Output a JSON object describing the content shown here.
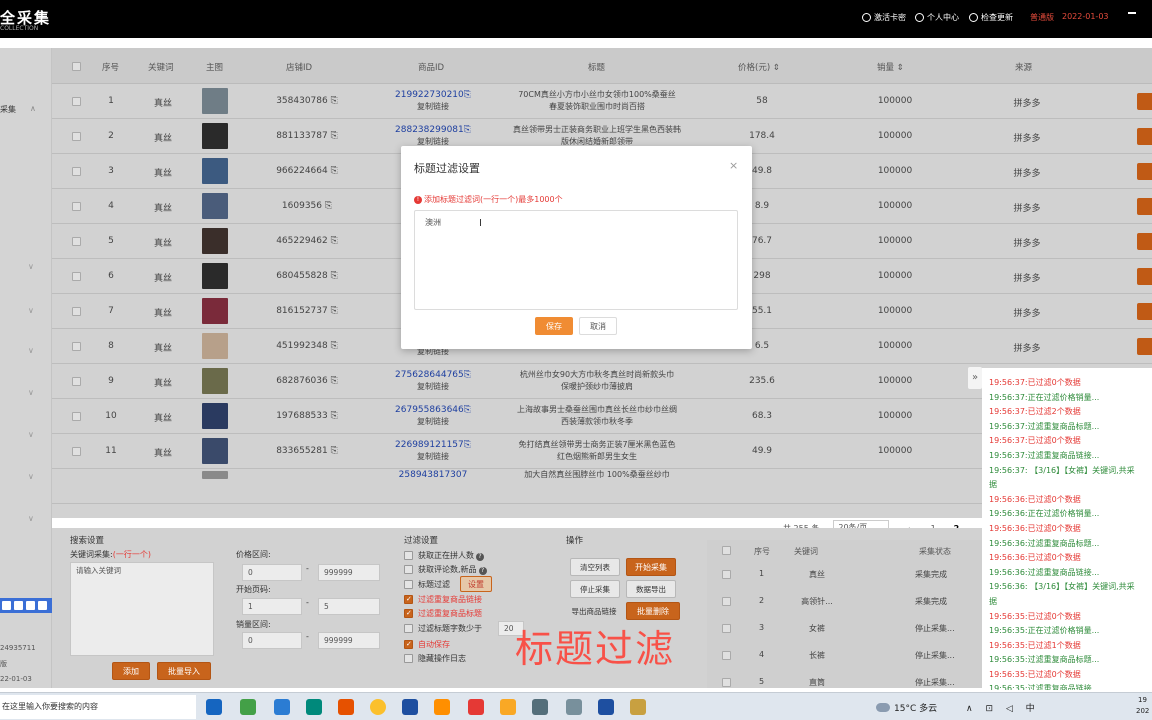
{
  "topbar": {
    "logo": "全采集",
    "logo_sub": "COLLECTION",
    "items": [
      "激活卡密",
      "个人中心",
      "检查更新"
    ],
    "version": "普通版",
    "date": "2022-01-03"
  },
  "sidebar": {
    "label": "采集",
    "account_id": "24935711",
    "version": "版",
    "date": "22-01-03"
  },
  "table": {
    "headers": [
      "序号",
      "关键词",
      "主图",
      "店铺ID",
      "商品ID",
      "标题",
      "价格(元)",
      "销量",
      "来源"
    ],
    "copy_link": "复制链接",
    "rows": [
      {
        "no": "1",
        "kw": "真丝",
        "shop": "358430786",
        "pid": "219922730210",
        "t1": "70CM真丝小方巾小丝巾女领巾100%桑蚕丝",
        "t2": "春夏装饰职业围巾时尚百搭",
        "price": "58",
        "sales": "100000",
        "src": "拼多多"
      },
      {
        "no": "2",
        "kw": "真丝",
        "shop": "881133787",
        "pid": "288238299081",
        "t1": "真丝领带男士正装商务职业上班学生黑色西装韩",
        "t2": "版休闲结婚新郎领带",
        "price": "178.4",
        "sales": "100000",
        "src": "拼多多"
      },
      {
        "no": "3",
        "kw": "真丝",
        "shop": "966224664",
        "pid": "2",
        "t1": "",
        "t2": "",
        "price": "49.8",
        "sales": "100000",
        "src": "拼多多"
      },
      {
        "no": "4",
        "kw": "真丝",
        "shop": "1609356",
        "pid": "2",
        "t1": "",
        "t2": "",
        "price": "8.9",
        "sales": "100000",
        "src": "拼多多"
      },
      {
        "no": "5",
        "kw": "真丝",
        "shop": "465229462",
        "pid": "2",
        "t1": "",
        "t2": "",
        "price": "76.7",
        "sales": "100000",
        "src": "拼多多"
      },
      {
        "no": "6",
        "kw": "真丝",
        "shop": "680455828",
        "pid": "2",
        "t1": "",
        "t2": "",
        "price": "298",
        "sales": "100000",
        "src": "拼多多"
      },
      {
        "no": "7",
        "kw": "真丝",
        "shop": "816152737",
        "pid": "2",
        "t1": "",
        "t2": "",
        "price": "55.1",
        "sales": "100000",
        "src": "拼多多"
      },
      {
        "no": "8",
        "kw": "真丝",
        "shop": "451992348",
        "pid": "",
        "t1": "",
        "t2": "女防晒纱巾披肩百搭丝巾",
        "price": "6.5",
        "sales": "100000",
        "src": "拼多多"
      },
      {
        "no": "9",
        "kw": "真丝",
        "shop": "682876036",
        "pid": "275628644765",
        "t1": "杭州丝巾女90大方巾秋冬真丝时尚新款头巾",
        "t2": "保暖护颈纱巾薄披肩",
        "price": "235.6",
        "sales": "100000",
        "src": "拼多多"
      },
      {
        "no": "10",
        "kw": "真丝",
        "shop": "197688533",
        "pid": "267955863646",
        "t1": "上海故事男士桑蚕丝围巾真丝长丝巾纱巾丝绸",
        "t2": "西装薄款领巾秋冬季",
        "price": "68.3",
        "sales": "100000",
        "src": "拼多多"
      },
      {
        "no": "11",
        "kw": "真丝",
        "shop": "833655281",
        "pid": "226989121157",
        "t1": "免打结真丝领带男士商务正装7厘米黑色蓝色",
        "t2": "红色烟熊新郎男生女生",
        "price": "49.9",
        "sales": "100000",
        "src": "拼多多"
      }
    ],
    "partial_row_pid": "258943817307",
    "partial_row_title": "加大自然真丝围脖丝巾 100%桑蚕丝纱巾"
  },
  "modal": {
    "title": "标题过滤设置",
    "close": "×",
    "hint": "添加标题过滤词(一行一个)最多1000个",
    "value": "澳洲",
    "save": "保存",
    "cancel": "取消"
  },
  "pagination": {
    "total": "共 255 条",
    "size": "20条/页",
    "prev": "‹",
    "p1": "1",
    "p2": "2"
  },
  "search_settings": {
    "title": "搜索设置",
    "kw_label": "关键词采集:",
    "kw_hint": "(一行一个)",
    "kw_placeholder": "请输入关键词",
    "price_label": "价格区间:",
    "price_min": "0",
    "price_max": "999999",
    "page_label": "开始页码:",
    "page_min": "1",
    "page_max": "5",
    "sales_label": "销量区间:",
    "sales_min": "0",
    "sales_max": "999999",
    "add": "添加",
    "batch_import": "批量导入"
  },
  "filter_settings": {
    "title": "过滤设置",
    "items": [
      "获取正在拼人数",
      "获取评论数,新品",
      "标题过滤",
      "过滤重复商品链接",
      "过滤重复商品标题",
      "过滤标题字数少于",
      "自动保存",
      "隐藏操作日志"
    ],
    "set_btn": "设置",
    "min_chars": "20"
  },
  "operations": {
    "title": "操作",
    "buttons": [
      "清空列表",
      "开始采集",
      "停止采集",
      "数据导出",
      "导出商品链接",
      "批量删除"
    ]
  },
  "task_table": {
    "headers": [
      "序号",
      "关键词",
      "采集状态"
    ],
    "rows": [
      {
        "no": "1",
        "kw": "真丝",
        "status": "采集完成"
      },
      {
        "no": "2",
        "kw": "高领针...",
        "status": "采集完成"
      },
      {
        "no": "3",
        "kw": "女裤",
        "status": "停止采集..."
      },
      {
        "no": "4",
        "kw": "长裤",
        "status": "停止采集..."
      },
      {
        "no": "5",
        "kw": "直筒",
        "status": "停止采集..."
      }
    ]
  },
  "overlay_text": "标题过滤",
  "log": {
    "collapse": "»",
    "lines": [
      {
        "t": "19:56:37:已过滤0个数据",
        "c": "red"
      },
      {
        "t": "19:56:37:正在过滤价格销量...",
        "c": "green"
      },
      {
        "t": "19:56:37:已过滤2个数据",
        "c": "red"
      },
      {
        "t": "19:56:37:过滤重复商品标题...",
        "c": "green"
      },
      {
        "t": "19:56:37:已过滤0个数据",
        "c": "red"
      },
      {
        "t": "19:56:37:过滤重复商品链接...",
        "c": "green"
      },
      {
        "t": "19:56:37: 【3/16】【女裤】关键词,共采",
        "c": "green"
      },
      {
        "t": "据",
        "c": "green"
      },
      {
        "t": "19:56:36:已过滤0个数据",
        "c": "red"
      },
      {
        "t": "19:56:36:正在过滤价格销量...",
        "c": "green"
      },
      {
        "t": "19:56:36:已过滤0个数据",
        "c": "red"
      },
      {
        "t": "19:56:36:过滤重复商品标题...",
        "c": "green"
      },
      {
        "t": "19:56:36:已过滤0个数据",
        "c": "red"
      },
      {
        "t": "19:56:36:过滤重复商品链接...",
        "c": "green"
      },
      {
        "t": "19:56:36: 【3/16】【女裤】关键词,共采",
        "c": "green"
      },
      {
        "t": "据",
        "c": "green"
      },
      {
        "t": "19:56:35:已过滤0个数据",
        "c": "red"
      },
      {
        "t": "19:56:35:正在过滤价格销量...",
        "c": "green"
      },
      {
        "t": "19:56:35:已过滤1个数据",
        "c": "red"
      },
      {
        "t": "19:56:35:过滤重复商品标题...",
        "c": "green"
      },
      {
        "t": "19:56:35:已过滤0个数据",
        "c": "red"
      },
      {
        "t": "19:56:35:过滤重复商品链接...",
        "c": "green"
      }
    ]
  },
  "taskbar": {
    "search": "在这里输入你要搜索的内容",
    "weather": "15°C 多云",
    "tray": "∧ ⊡ ◁ 中",
    "clock1": "19",
    "clock2": "202"
  }
}
